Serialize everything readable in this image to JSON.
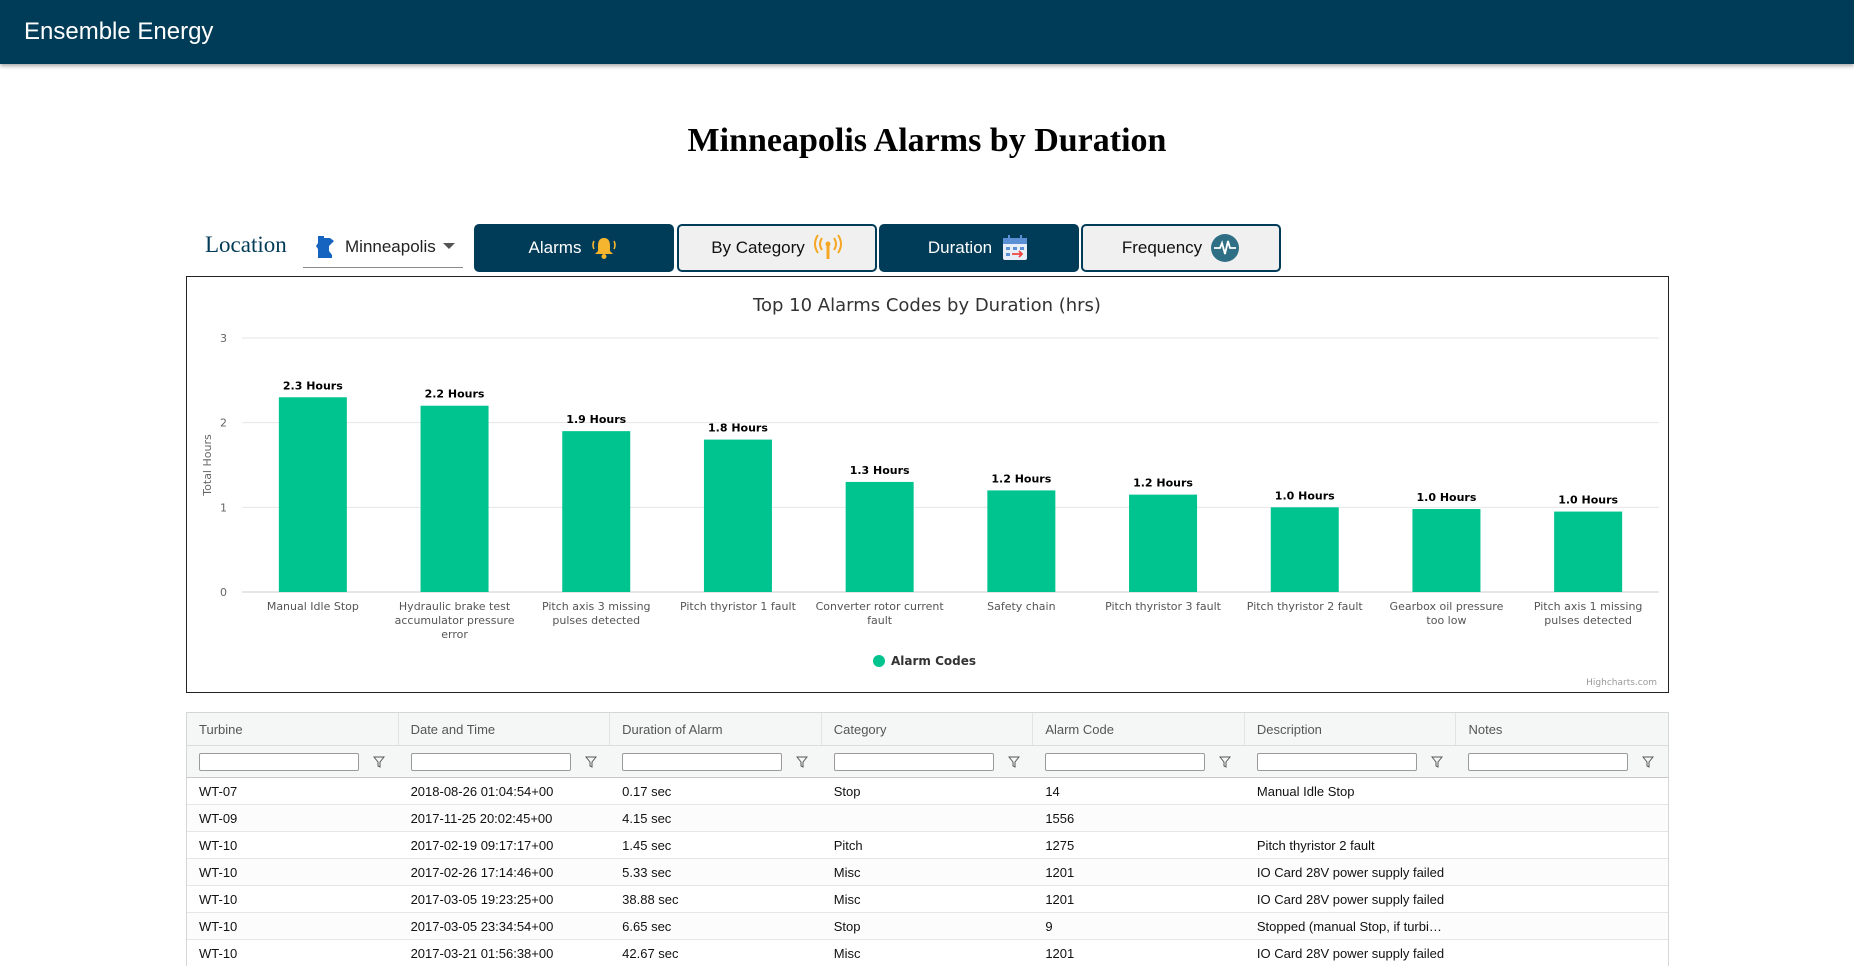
{
  "app": {
    "title": "Ensemble Energy"
  },
  "page": {
    "title": "Minneapolis Alarms by Duration"
  },
  "controls": {
    "location_label": "Location",
    "location_value": "Minneapolis",
    "tabs": [
      {
        "label": "Alarms",
        "icon": "bell-icon",
        "active": true
      },
      {
        "label": "By Category",
        "icon": "signal-antenna-icon",
        "active": false
      },
      {
        "label": "Duration",
        "icon": "calendar-icon",
        "active": true
      },
      {
        "label": "Frequency",
        "icon": "pulse-icon",
        "active": false
      }
    ]
  },
  "colors": {
    "header": "#003c57",
    "bar": "#00c48f",
    "accent_icon": "#f5a623"
  },
  "chart_data": {
    "type": "bar",
    "title": "Top 10 Alarms Codes by Duration (hrs)",
    "ylabel": "Total Hours",
    "ylim": [
      0,
      3
    ],
    "yticks": [
      "0",
      "1",
      "2",
      "3"
    ],
    "categories": [
      "Manual Idle Stop",
      "Hydraulic brake test accumulator pressure error",
      "Pitch axis 3 missing pulses detected",
      "Pitch thyristor 1 fault",
      "Converter rotor current fault",
      "Safety chain",
      "Pitch thyristor 3 fault",
      "Pitch thyristor 2 fault",
      "Gearbox oil pressure too low",
      "Pitch axis 1 missing pulses detected"
    ],
    "category_lines": [
      [
        "Manual Idle Stop"
      ],
      [
        "Hydraulic brake test",
        "accumulator pressure",
        "error"
      ],
      [
        "Pitch axis 3 missing",
        "pulses detected"
      ],
      [
        "Pitch thyristor 1 fault"
      ],
      [
        "Converter rotor current",
        "fault"
      ],
      [
        "Safety chain"
      ],
      [
        "Pitch thyristor 3 fault"
      ],
      [
        "Pitch thyristor 2 fault"
      ],
      [
        "Gearbox oil pressure",
        "too low"
      ],
      [
        "Pitch axis 1 missing",
        "pulses detected"
      ]
    ],
    "series": [
      {
        "name": "Alarm Codes",
        "values": [
          2.3,
          2.2,
          1.9,
          1.8,
          1.3,
          1.2,
          1.15,
          1.0,
          0.98,
          0.95
        ],
        "data_labels": [
          "2.3 Hours",
          "2.2 Hours",
          "1.9 Hours",
          "1.8 Hours",
          "1.3 Hours",
          "1.2 Hours",
          "1.2 Hours",
          "1.0 Hours",
          "1.0 Hours",
          "1.0 Hours"
        ]
      }
    ],
    "legend": "bottom-center",
    "grid": true,
    "credits": "Highcharts.com"
  },
  "grid": {
    "columns": [
      "Turbine",
      "Date and Time",
      "Duration of Alarm",
      "Category",
      "Alarm Code",
      "Description",
      "Notes"
    ],
    "rows": [
      [
        "WT-07",
        "2018-08-26 01:04:54+00",
        "0.17 sec",
        "Stop",
        "14",
        "Manual Idle Stop",
        ""
      ],
      [
        "WT-09",
        "2017-11-25 20:02:45+00",
        "4.15 sec",
        "",
        "1556",
        "",
        ""
      ],
      [
        "WT-10",
        "2017-02-19 09:17:17+00",
        "1.45 sec",
        "Pitch",
        "1275",
        "Pitch thyristor 2 fault",
        ""
      ],
      [
        "WT-10",
        "2017-02-26 17:14:46+00",
        "5.33 sec",
        "Misc",
        "1201",
        "IO Card 28V power supply failed",
        ""
      ],
      [
        "WT-10",
        "2017-03-05 19:23:25+00",
        "38.88 sec",
        "Misc",
        "1201",
        "IO Card 28V power supply failed",
        ""
      ],
      [
        "WT-10",
        "2017-03-05 23:34:54+00",
        "6.65 sec",
        "Stop",
        "9",
        "Stopped (manual Stop, if turbi…",
        ""
      ],
      [
        "WT-10",
        "2017-03-21 01:56:38+00",
        "42.67 sec",
        "Misc",
        "1201",
        "IO Card 28V power supply failed",
        ""
      ]
    ]
  }
}
